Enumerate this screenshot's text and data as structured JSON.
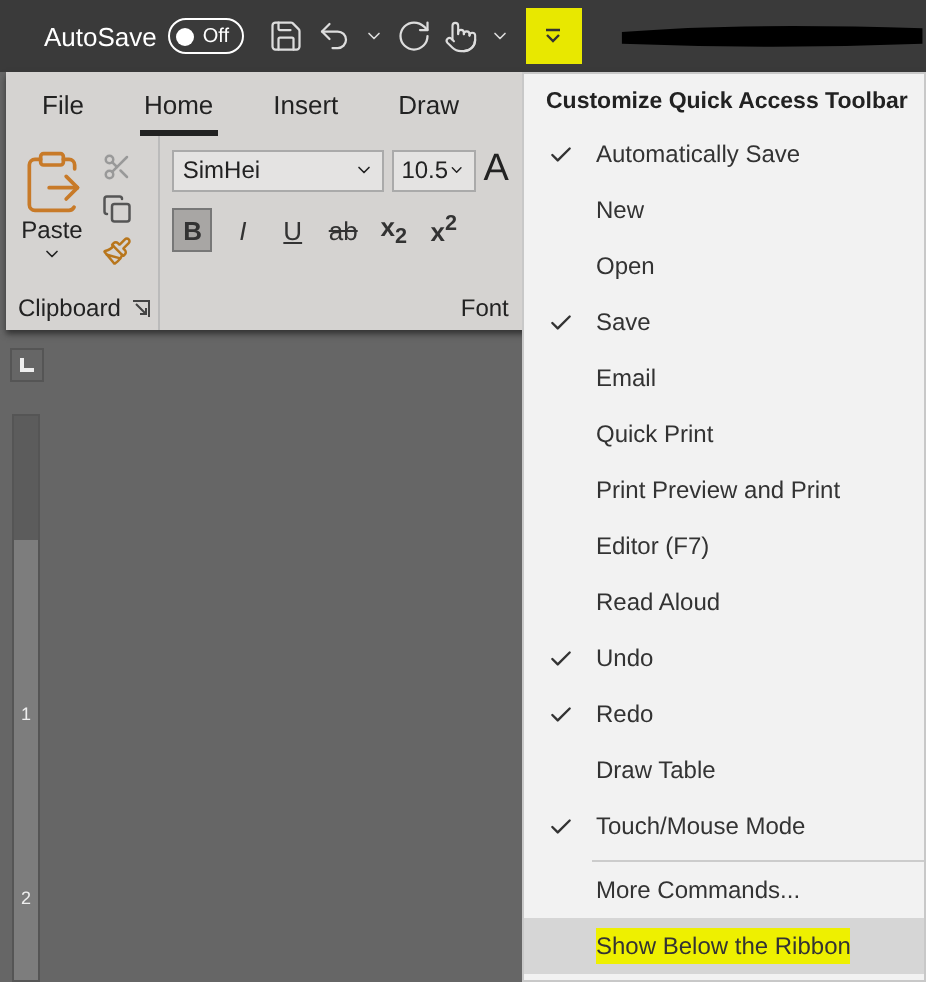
{
  "title_bar": {
    "autosave_label": "AutoSave",
    "autosave_toggle": {
      "label": "Off",
      "on": false
    },
    "customize_button": {
      "highlighted": true
    }
  },
  "ribbon": {
    "tabs": [
      {
        "label": "File",
        "selected": false
      },
      {
        "label": "Home",
        "selected": true
      },
      {
        "label": "Insert",
        "selected": false
      },
      {
        "label": "Draw",
        "selected": false
      }
    ],
    "clipboard": {
      "paste_label": "Paste",
      "group_label": "Clipboard"
    },
    "font": {
      "font_name": "SimHei",
      "font_size": "10.5",
      "grow_label": "A",
      "group_label": "Font",
      "format_buttons": [
        {
          "label": "B",
          "kind": "bold",
          "pressed": true
        },
        {
          "label": "I",
          "kind": "italic",
          "pressed": false
        },
        {
          "label": "U",
          "kind": "underline",
          "pressed": false
        },
        {
          "label": "ab",
          "kind": "strike",
          "pressed": false
        },
        {
          "label": "x$_{2}$",
          "kind": "script",
          "pressed": false
        },
        {
          "label": "x$^{2}$",
          "kind": "script",
          "pressed": false
        }
      ]
    }
  },
  "ruler": {
    "marks": [
      "1",
      "2"
    ]
  },
  "menu": {
    "title": "Customize Quick Access Toolbar",
    "items": [
      {
        "label": "Automatically Save",
        "checked": true
      },
      {
        "label": "New",
        "checked": false
      },
      {
        "label": "Open",
        "checked": false
      },
      {
        "label": "Save",
        "checked": true
      },
      {
        "label": "Email",
        "checked": false
      },
      {
        "label": "Quick Print",
        "checked": false
      },
      {
        "label": "Print Preview and Print",
        "checked": false
      },
      {
        "label": "Editor (F7)",
        "checked": false
      },
      {
        "label": "Read Aloud",
        "checked": false
      },
      {
        "label": "Undo",
        "checked": true
      },
      {
        "label": "Redo",
        "checked": true
      },
      {
        "label": "Draw Table",
        "checked": false
      },
      {
        "label": "Touch/Mouse Mode",
        "checked": true
      }
    ],
    "commands": [
      {
        "label": "More Commands...",
        "hovered": false,
        "highlighted": false
      },
      {
        "label": "Show Below the Ribbon",
        "hovered": true,
        "highlighted": true
      }
    ]
  }
}
